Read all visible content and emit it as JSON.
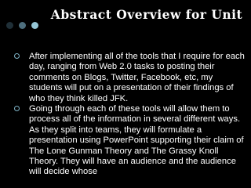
{
  "slide": {
    "title": "Abstract Overview for Unit",
    "bullets": [
      "After implementing all of the tools that I require for each day, ranging from Web 2.0 tasks to posting their comments on Blogs, Twitter, Facebook, etc, my students will put on a presentation of their findings of who they think killed JFK.",
      "Going through each of these tools will allow them to process all of the information in several different ways. As they split into teams, they will formulate a presentation using PowerPoint supporting their claim of The Lone Gunman Theory and The Grassy Knoll Theory. They will have an audience and the audience will decide whose"
    ]
  },
  "colors": {
    "background": "#000000",
    "text": "#ffffff",
    "dot_dark": "#1f2f37",
    "dot_mid": "#4d6e7d",
    "dot_light": "#96c6d6",
    "bullet_ring": "#7fb3c6"
  }
}
